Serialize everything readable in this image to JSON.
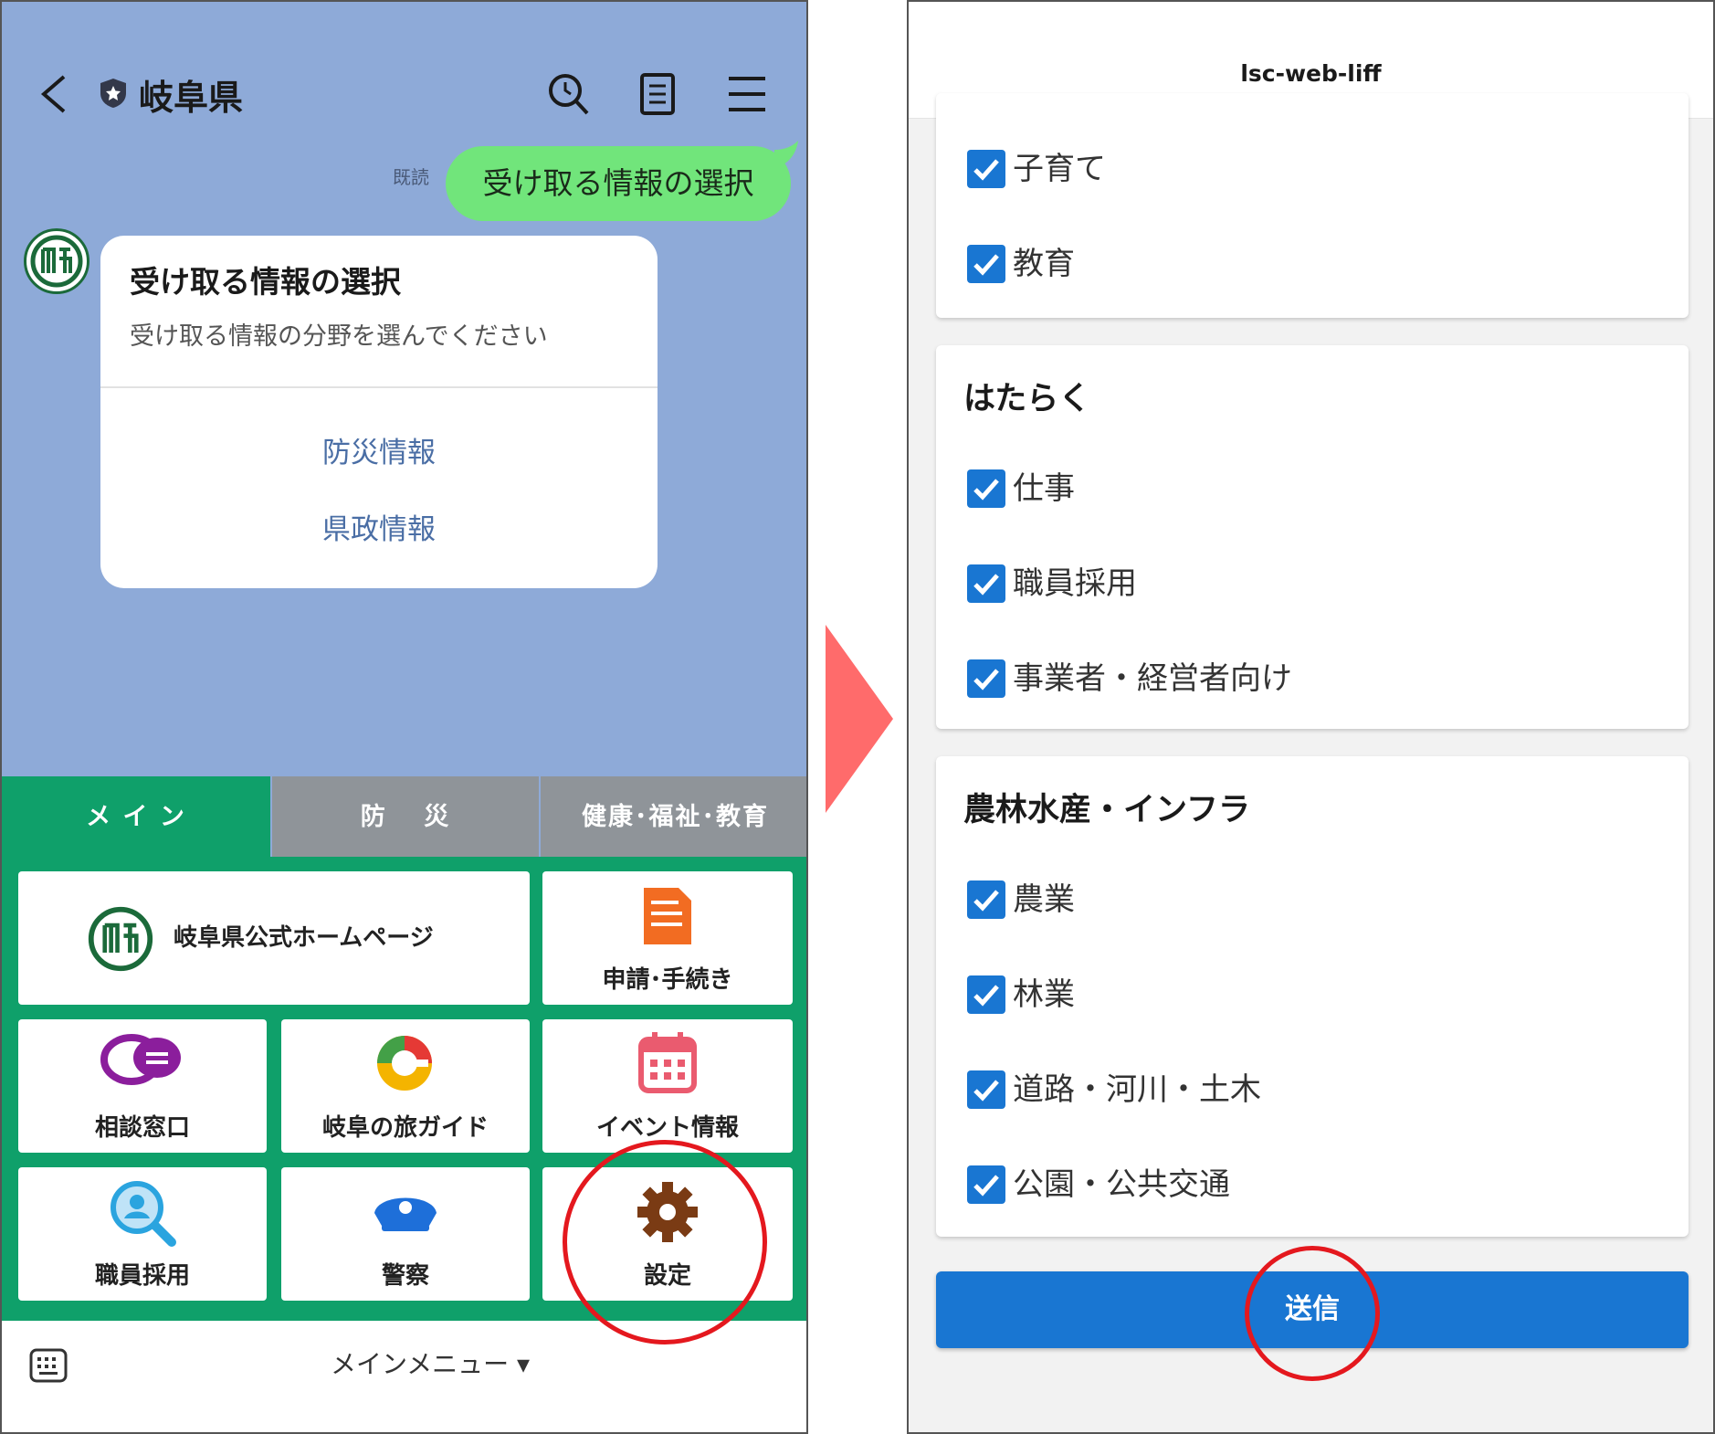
{
  "left": {
    "title": "岐阜県",
    "read_mark": "既読",
    "user_message": "受け取る情報の選択",
    "card": {
      "title": "受け取る情報の選択",
      "subtitle": "受け取る情報の分野を選んでください",
      "buttons": [
        "防災情報",
        "県政情報"
      ]
    },
    "tabs": [
      "メ イ ン",
      "防　 災",
      "健康･福祉･教育"
    ],
    "menu_items": {
      "homepage": "岐阜県公式ホームページ",
      "application": "申請･手続き",
      "consult": "相談窓口",
      "travel": "岐阜の旅ガイド",
      "event": "イベント情報",
      "recruit": "職員採用",
      "police": "警察",
      "settings": "設定"
    },
    "bottom_menu": "メインメニュー ▾",
    "colors": {
      "chat_bg": "#8eaad8",
      "bubble": "#71e57b",
      "menu_green": "#0fa06a",
      "tab_gray": "#8f9499",
      "link": "#4a6ea5"
    }
  },
  "right": {
    "app_title": "lsc-web-liff",
    "panel1": {
      "items": [
        "子育て",
        "教育"
      ]
    },
    "panel2": {
      "title": "はたらく",
      "items": [
        "仕事",
        "職員採用",
        "事業者・経営者向け"
      ]
    },
    "panel3": {
      "title": "農林水産・インフラ",
      "items": [
        "農業",
        "林業",
        "道路・河川・土木",
        "公園・公共交通"
      ]
    },
    "submit": "送信",
    "colors": {
      "checkbox": "#1976d2",
      "button": "#1976d2",
      "highlight_circle": "#e4181e",
      "arrow": "#ff6b6b"
    }
  }
}
